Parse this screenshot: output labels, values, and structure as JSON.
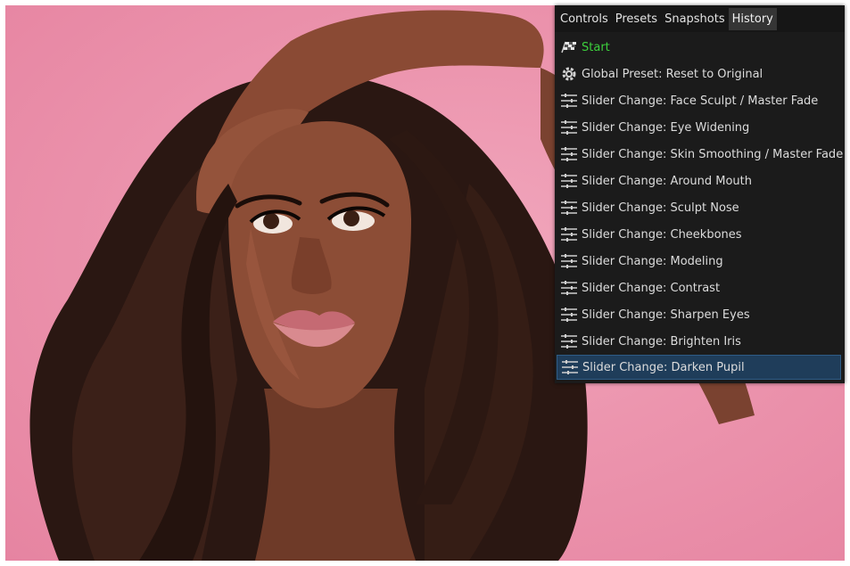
{
  "panel": {
    "tabs": [
      {
        "label": "Controls",
        "active": false
      },
      {
        "label": "Presets",
        "active": false
      },
      {
        "label": "Snapshots",
        "active": false
      },
      {
        "label": "History",
        "active": true
      }
    ],
    "items": [
      {
        "label": "Start",
        "icon": "checkered-flag-icon"
      },
      {
        "label": "Global Preset: Reset to Original",
        "icon": "gear-icon"
      },
      {
        "label": "Slider Change: Face Sculpt / Master Fade",
        "icon": "sliders-icon"
      },
      {
        "label": "Slider Change: Eye Widening",
        "icon": "sliders-icon"
      },
      {
        "label": "Slider Change: Skin Smoothing / Master Fade",
        "icon": "sliders-icon"
      },
      {
        "label": "Slider Change: Around Mouth",
        "icon": "sliders-icon"
      },
      {
        "label": "Slider Change: Sculpt Nose",
        "icon": "sliders-icon"
      },
      {
        "label": "Slider Change: Cheekbones",
        "icon": "sliders-icon"
      },
      {
        "label": "Slider Change: Modeling",
        "icon": "sliders-icon"
      },
      {
        "label": "Slider Change: Contrast",
        "icon": "sliders-icon"
      },
      {
        "label": "Slider Change: Sharpen Eyes",
        "icon": "sliders-icon"
      },
      {
        "label": "Slider Change: Brighten Iris",
        "icon": "sliders-icon"
      },
      {
        "label": "Slider Change: Darken Pupil",
        "icon": "sliders-icon",
        "selected": true
      }
    ]
  },
  "colors": {
    "panel_bg": "#1b1b1b",
    "start_text": "#3ccf3c",
    "selected_bg": "#1f3d5a",
    "photo_bg": "#ec95ae"
  }
}
